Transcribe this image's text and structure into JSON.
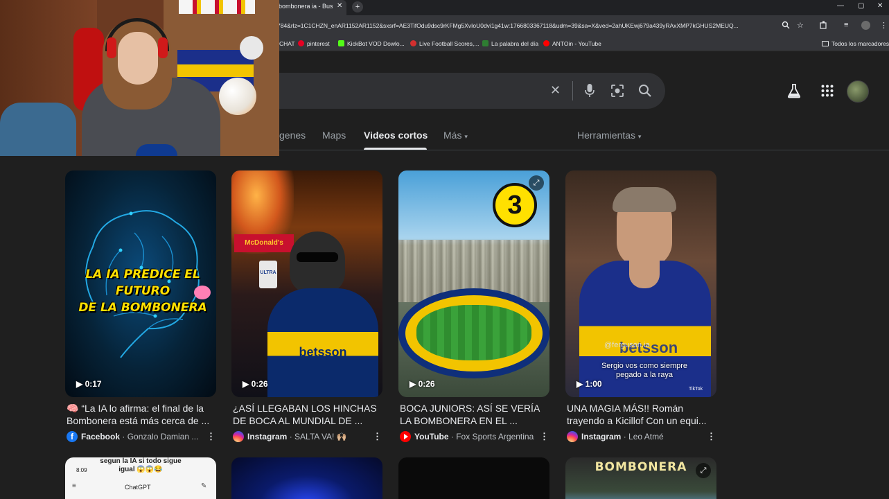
{
  "browser": {
    "tab_title": "bombonera ia - Buscar con Google",
    "tab_close": "✕",
    "new_tab": "+",
    "url": "784&rlz=1C1CHZN_enAR1152AR1152&sxsrf=AE3TifOdu9dsc9rKFMg5XvIoU0dvi1g41w:1766803367118&udm=39&sa=X&ved=2ahUKEwj679a439yRAxXMP7kGHUS2MEUQ...",
    "window_controls": [
      "—",
      "▢",
      "✕"
    ],
    "bookmarks": [
      {
        "label": "CHAT",
        "color": "#35363a"
      },
      {
        "label": "pinterest",
        "color": "#e60023"
      },
      {
        "label": "KickBot VOD Dowlo...",
        "color": "#53fc18"
      },
      {
        "label": "Live Football Scores,...",
        "color": "#d32f2f"
      },
      {
        "label": "La palabra del día",
        "color": "#2e7d32"
      },
      {
        "label": "ANTOin - YouTube",
        "color": "#ff0000"
      }
    ],
    "bookmarks_folder": "Todos los marcadores"
  },
  "search": {
    "clear_icon": "✕"
  },
  "nav": {
    "tabs": [
      {
        "label": "genes",
        "active": false
      },
      {
        "label": "Maps",
        "active": false
      },
      {
        "label": "Videos cortos",
        "active": true
      },
      {
        "label": "Más",
        "active": false
      }
    ],
    "tools": "Herramientas",
    "more_caret": "▾"
  },
  "cards": [
    {
      "duration": "▶ 0:17",
      "title": "🧠 “La IA lo afirma: el final de la Bombonera está más cerca de ...",
      "source": "Facebook",
      "author": "· Gonzalo Damian ...",
      "source_color": "#1877f2",
      "overlay_text": [
        "LA IA PREDICE EL FUTURO",
        "DE LA BOMBONERA"
      ]
    },
    {
      "duration": "▶ 0:26",
      "title": "¿ASÍ LLEGABAN LOS HINCHAS DE BOCA AL MUNDIAL DE ...",
      "source": "Instagram",
      "author": "· SALTA VA! 🙌🏼",
      "source_color": "#d6249f",
      "overlay_text": [
        "betsson",
        "McDonald's",
        "ULTRA"
      ]
    },
    {
      "duration": "▶ 0:26",
      "title": "BOCA JUNIORS: ASÍ SE VERÍA LA BOMBONERA EN EL ...",
      "source": "YouTube",
      "author": "· Fox Sports Argentina",
      "source_color": "#ff0000",
      "overlay_text": [
        "3"
      ]
    },
    {
      "duration": "▶ 1:00",
      "title": "UNA MAGIA MÁS!! Román trayendo a Kicillof Con un equi...",
      "source": "Instagram",
      "author": "· Leo Atmé",
      "source_color": "#d6249f",
      "overlay_text": [
        "Sergio vos como siempre",
        "pegado a la raya",
        "@ferguson.ia",
        "betsson",
        "TikTok"
      ]
    }
  ],
  "second_row": {
    "card1_text": [
      "segun la IA si todo sigue",
      "igual 😱😱😂",
      "8:09",
      "ChatGPT"
    ],
    "card4_text": "BOMBONERA"
  },
  "colors": {
    "page_bg": "#1f1f1f",
    "chrome_bg": "#35363a",
    "searchbox_bg": "#303134",
    "accent_text": "#e8eaed"
  }
}
